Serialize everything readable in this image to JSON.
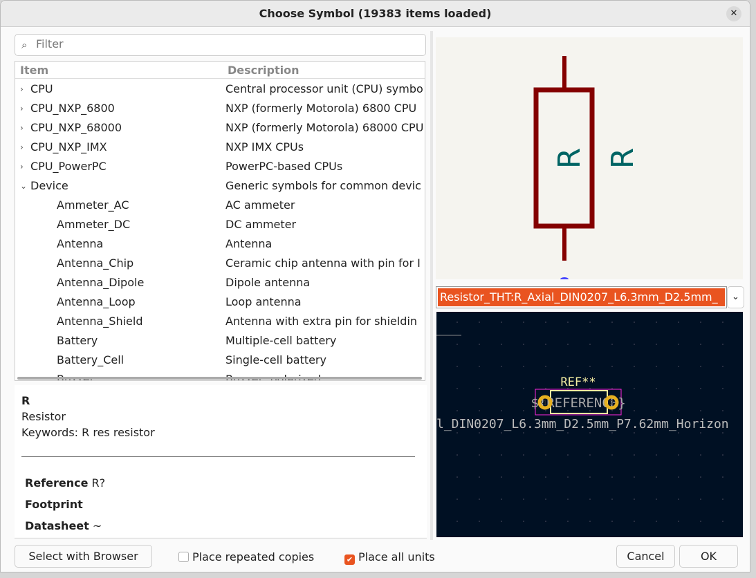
{
  "window": {
    "title": "Choose Symbol (19383 items loaded)",
    "close_icon": "close-icon"
  },
  "filter": {
    "placeholder": "Filter",
    "value": "",
    "icon": "search-icon"
  },
  "tree": {
    "columns": [
      "Item",
      "Description"
    ],
    "rows": [
      {
        "name": "CPU",
        "desc": "Central processor unit (CPU) symbo",
        "level": 0,
        "expanded": false
      },
      {
        "name": "CPU_NXP_6800",
        "desc": "NXP (formerly Motorola) 6800 CPU",
        "level": 0,
        "expanded": false
      },
      {
        "name": "CPU_NXP_68000",
        "desc": "NXP (formerly Motorola) 68000 CPU",
        "level": 0,
        "expanded": false
      },
      {
        "name": "CPU_NXP_IMX",
        "desc": "NXP IMX CPUs",
        "level": 0,
        "expanded": false
      },
      {
        "name": "CPU_PowerPC",
        "desc": "PowerPC-based CPUs",
        "level": 0,
        "expanded": false
      },
      {
        "name": "Device",
        "desc": "Generic symbols for common devic",
        "level": 0,
        "expanded": true
      },
      {
        "name": "Ammeter_AC",
        "desc": "AC ammeter",
        "level": 1
      },
      {
        "name": "Ammeter_DC",
        "desc": "DC ammeter",
        "level": 1
      },
      {
        "name": "Antenna",
        "desc": "Antenna",
        "level": 1
      },
      {
        "name": "Antenna_Chip",
        "desc": "Ceramic chip antenna with pin for I",
        "level": 1
      },
      {
        "name": "Antenna_Dipole",
        "desc": "Dipole antenna",
        "level": 1
      },
      {
        "name": "Antenna_Loop",
        "desc": "Loop antenna",
        "level": 1
      },
      {
        "name": "Antenna_Shield",
        "desc": "Antenna with extra pin for shieldin",
        "level": 1
      },
      {
        "name": "Battery",
        "desc": "Multiple-cell battery",
        "level": 1
      },
      {
        "name": "Battery_Cell",
        "desc": "Single-cell battery",
        "level": 1
      },
      {
        "name": "Buzzer",
        "desc": "Buzzer, polarized",
        "level": 1
      }
    ]
  },
  "details": {
    "name": "R",
    "description": "Resistor",
    "keywords": "Keywords: R res resistor",
    "fields": [
      {
        "label": "Reference",
        "value": "R?"
      },
      {
        "label": "Footprint",
        "value": ""
      },
      {
        "label": "Datasheet",
        "value": "~"
      }
    ]
  },
  "symbol_preview": {
    "ref": "R",
    "value": "R",
    "body_color": "#840000",
    "text_color": "#006464"
  },
  "footprint": {
    "selected": "Resistor_THT:R_Axial_DIN0207_L6.3mm_D2.5mm_",
    "ref_text": "REF**",
    "value_text": "${REFERENCE}",
    "fp_name": "l_DIN0207_L6.3mm_D2.5mm_P7.62mm_Horizon",
    "pads": [
      "1",
      "2"
    ]
  },
  "buttons": {
    "browser": "Select with Browser",
    "cancel": "Cancel",
    "ok": "OK"
  },
  "options": {
    "repeated": {
      "label": "Place repeated copies",
      "checked": false
    },
    "all_units": {
      "label": "Place all units",
      "checked": true
    }
  },
  "accent": "#e95420"
}
